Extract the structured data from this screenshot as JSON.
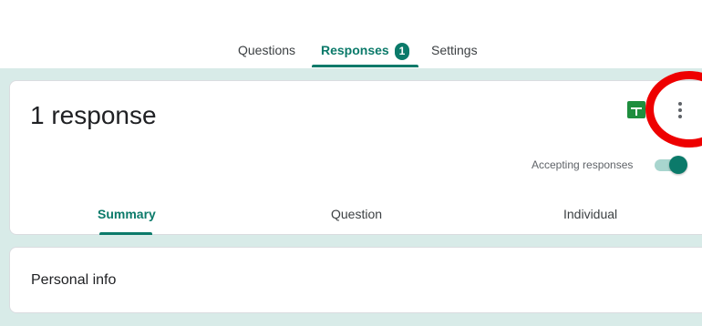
{
  "nav": {
    "tabs": [
      {
        "label": "Questions"
      },
      {
        "label": "Responses",
        "badge": "1"
      },
      {
        "label": "Settings"
      }
    ]
  },
  "responses": {
    "title": "1 response",
    "accepting_label": "Accepting responses",
    "accepting": true,
    "sub_tabs": [
      {
        "label": "Summary"
      },
      {
        "label": "Question"
      },
      {
        "label": "Individual"
      }
    ],
    "link_sheets_icon": "sheets-icon",
    "more_icon": "more-vert-icon"
  },
  "section": {
    "title": "Personal info"
  },
  "colors": {
    "accent": "#0b7a6a",
    "background": "#d8ebe8",
    "highlight": "#ee0000",
    "sheets": "#1e8e3e"
  }
}
